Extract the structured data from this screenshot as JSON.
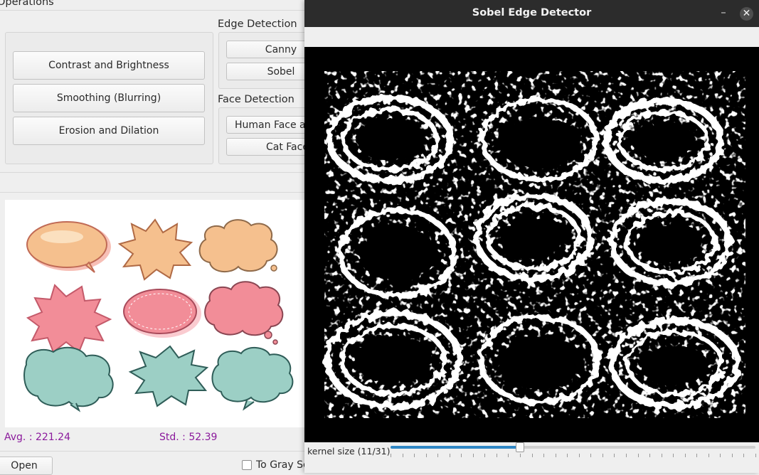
{
  "main_window": {
    "operations_title": "Operations",
    "edge_detection_title": "Edge Detection",
    "face_detection_title": "Face Detection",
    "buttons": {
      "contrast": "Contrast and Brightness",
      "smoothing": "Smoothing (Blurring)",
      "erosion": "Erosion and Dilation",
      "canny": "Canny",
      "sobel": "Sobel",
      "human_face": "Human Face and Eyes",
      "cat_face": "Cat Face"
    },
    "stats": {
      "avg": "Avg. : 221.24",
      "std": "Std. : 52.39"
    },
    "open_button": "Open",
    "gray_checkbox_label": "To Gray Scale"
  },
  "sobel_window": {
    "title": "Sobel Edge Detector",
    "minimize_icon": "minimize-icon",
    "close_icon": "close-icon",
    "slider": {
      "label": "kernel size (11/31)",
      "value": 11,
      "max": 31
    }
  },
  "preview_bubbles": [
    {
      "shape": "oval",
      "color": "#f5c08e"
    },
    {
      "shape": "burst",
      "color": "#f5c08e"
    },
    {
      "shape": "cloud",
      "color": "#f5c08e"
    },
    {
      "shape": "burst",
      "color": "#f28d98"
    },
    {
      "shape": "oval",
      "color": "#f28d98"
    },
    {
      "shape": "cloud",
      "color": "#f28d98"
    },
    {
      "shape": "cloud",
      "color": "#9ccfc5"
    },
    {
      "shape": "burst",
      "color": "#9ccfc5"
    },
    {
      "shape": "cloud",
      "color": "#9ccfc5"
    }
  ]
}
